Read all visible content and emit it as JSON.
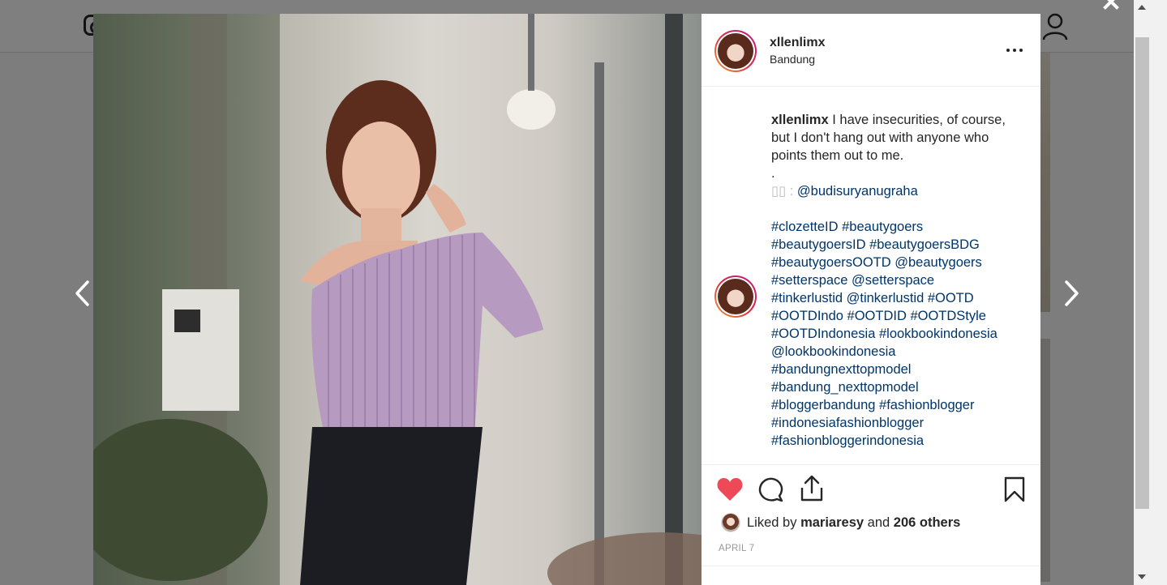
{
  "post": {
    "username": "xllenlimx",
    "location": "Bandung",
    "date": "APRIL 7"
  },
  "caption": {
    "username": "xllenlimx",
    "text": "I have insecurities, of course, but I don't hang out with anyone who points them out to me.",
    "dot": ".",
    "credit_prefix": "▯▯ : ",
    "credit_handle": "@budisuryanugraha",
    "tag_lines": [
      "#clozetteID #beautygoers",
      "#beautygoersID #beautygoersBDG",
      "#beautygoersOOTD @beautygoers",
      "#setterspace @setterspace",
      "#tinkerlustid @tinkerlustid #OOTD",
      "#OOTDIndo #OOTDID #OOTDStyle",
      "#OOTDIndonesia #lookbookindonesia",
      "@lookbookindonesia",
      "#bandungnexttopmodel",
      "#bandung_nexttopmodel",
      "#bloggerbandung #fashionblogger",
      "#indonesiafashionblogger",
      "#fashionbloggerindonesia"
    ]
  },
  "likes": {
    "prefix": "Liked by",
    "liker": "mariaresy",
    "conjunction": "and",
    "others": "206 others"
  },
  "icons": {
    "close": "close-icon",
    "prev": "chevron-left-icon",
    "next": "chevron-right-icon",
    "more": "more-options-icon",
    "like": "heart-filled-icon",
    "comment": "comment-bubble-icon",
    "share": "share-icon",
    "save": "bookmark-icon"
  },
  "colors": {
    "like_active": "#ed4956",
    "link": "#003569",
    "text": "#262626",
    "muted": "#999999"
  }
}
